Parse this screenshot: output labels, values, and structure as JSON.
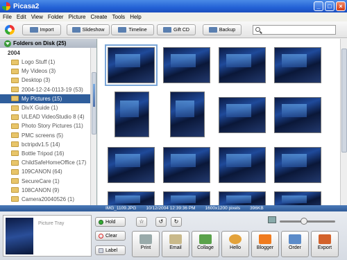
{
  "window": {
    "title": "Picasa2"
  },
  "menu": [
    "File",
    "Edit",
    "View",
    "Folder",
    "Picture",
    "Create",
    "Tools",
    "Help"
  ],
  "toolbar": {
    "import": "Import",
    "slideshow": "Slideshow",
    "timeline": "Timeline",
    "giftcd": "Gift CD",
    "backup": "Backup",
    "search_value": ""
  },
  "folders": {
    "header": "Folders on Disk (25)",
    "year": "2004",
    "items": [
      "Logo Stuff (1)",
      "My Videos (3)",
      "Desktop (3)",
      "2004-12-24-0113-19 (53)",
      "My Pictures (15)",
      "DivX Guide (1)",
      "ULEAD VideoStudio 8 (4)",
      "Photo Story Pictures (11)",
      "PMC screens (5)",
      "bctripdv1.5 (14)",
      "Bottle Tripod (16)",
      "ChildSafeHomeOffice (17)",
      "109CANON (64)",
      "SecureCare (1)",
      "108CANON (9)",
      "Camera20040526 (1)"
    ],
    "selected_index": 4
  },
  "status": {
    "filename": "IMG_1109.JPG",
    "date": "10/12/2004 12:39:36 PM",
    "size": "1600x1200 pixels",
    "filesize": "396KB"
  },
  "tray": {
    "label": "Picture Tray",
    "hold": "Hold",
    "clear": "Clear",
    "label_btn": "Label"
  },
  "actions": [
    "Print",
    "Email",
    "Collage",
    "Hello",
    "Blogger",
    "Order",
    "Export"
  ],
  "colors": {
    "accent": "#2f5e9c",
    "titlebar": "#2462d6"
  }
}
